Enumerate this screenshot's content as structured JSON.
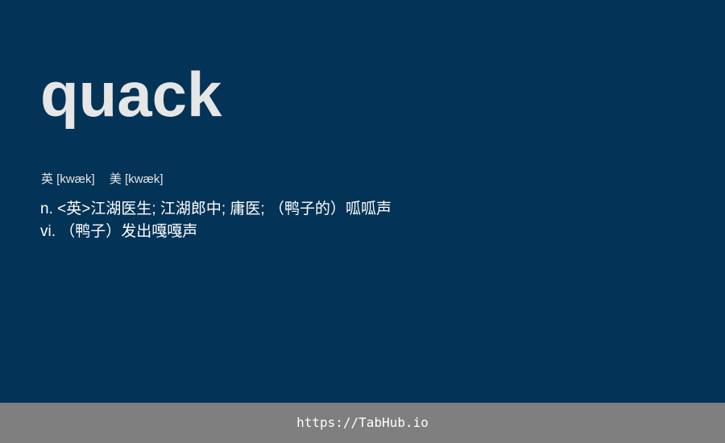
{
  "card": {
    "word": "quack",
    "phonetics": [
      {
        "label": "英 [kwæk]"
      },
      {
        "label": "美 [kwæk]"
      }
    ],
    "definitions": [
      "n. <英>江湖医生; 江湖郎中; 庸医; （鸭子的）呱呱声",
      "vi. （鸭子）发出嘎嘎声"
    ]
  },
  "footer": {
    "url": "https://TabHub.io"
  },
  "colors": {
    "background": "#033356",
    "footer_background": "#7f7f7f",
    "word_text": "#e6e6e6",
    "body_text": "#ffffff"
  }
}
